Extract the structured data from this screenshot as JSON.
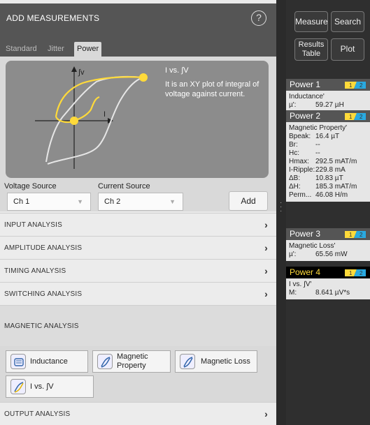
{
  "dialog": {
    "title": "ADD MEASUREMENTS",
    "help_icon": "help-icon",
    "tabs": [
      {
        "label": "Standard",
        "active": false
      },
      {
        "label": "Jitter",
        "active": false
      },
      {
        "label": "Power",
        "active": true
      }
    ],
    "preview": {
      "title": "I vs. ∫V",
      "description": "It is an XY plot of integral of voltage against current.",
      "y_axis_label": "∫v",
      "x_axis_label": "I"
    },
    "voltage_source": {
      "label": "Voltage Source",
      "value": "Ch 1"
    },
    "current_source": {
      "label": "Current Source",
      "value": "Ch 2"
    },
    "add_label": "Add",
    "sections": [
      {
        "label": "INPUT ANALYSIS",
        "expanded": false
      },
      {
        "label": "AMPLITUDE ANALYSIS",
        "expanded": false
      },
      {
        "label": "TIMING ANALYSIS",
        "expanded": false
      },
      {
        "label": "SWITCHING ANALYSIS",
        "expanded": false
      },
      {
        "label": "MAGNETIC ANALYSIS",
        "expanded": true
      },
      {
        "label": "OUTPUT ANALYSIS",
        "expanded": false
      }
    ],
    "magnetic_items": [
      {
        "label": "Inductance",
        "icon": "inductance-icon"
      },
      {
        "label": "Magnetic Property",
        "icon": "magnetic-property-icon"
      },
      {
        "label": "Magnetic Loss",
        "icon": "magnetic-loss-icon"
      },
      {
        "label": "I vs. ∫V",
        "icon": "i-vs-integral-v-icon"
      }
    ]
  },
  "right_panel": {
    "buttons": {
      "measure": "Measure",
      "search": "Search",
      "results_line1": "Results",
      "results_line2": "Table",
      "plot": "Plot"
    },
    "channel_tag": {
      "ch1": "1",
      "ch2": "2"
    },
    "badges": [
      {
        "title": "Power 1",
        "name": "Inductance'",
        "rows": [
          {
            "k": "µ':",
            "v": "59.27 µH"
          }
        ]
      },
      {
        "title": "Power 2",
        "name": "Magnetic Property'",
        "rows": [
          {
            "k": "Bpeak:",
            "v": "16.4 µT"
          },
          {
            "k": "Br:",
            "v": "--"
          },
          {
            "k": "Hc:",
            "v": "--"
          },
          {
            "k": "Hmax:",
            "v": "292.5 mAT/m"
          },
          {
            "k": "I-Ripple:",
            "v": "229.8 mA"
          },
          {
            "k": "ΔB:",
            "v": "10.83 µT"
          },
          {
            "k": "ΔH:",
            "v": "185.3 mAT/m"
          },
          {
            "k": "Perm...",
            "v": "46.08 H/m"
          }
        ]
      },
      {
        "title": "Power 3",
        "name": "Magnetic Loss'",
        "rows": [
          {
            "k": "µ':",
            "v": "65.56 mW"
          }
        ]
      },
      {
        "title": "Power 4",
        "name": "I vs. ∫V'",
        "rows": [
          {
            "k": "M:",
            "v": "8.641 µV*s"
          }
        ]
      }
    ]
  },
  "colors": {
    "accent_yellow": "#ffda3a",
    "ch2_blue": "#29a9e0",
    "badge_header": "#555555",
    "selected_badge_header": "#000000"
  }
}
